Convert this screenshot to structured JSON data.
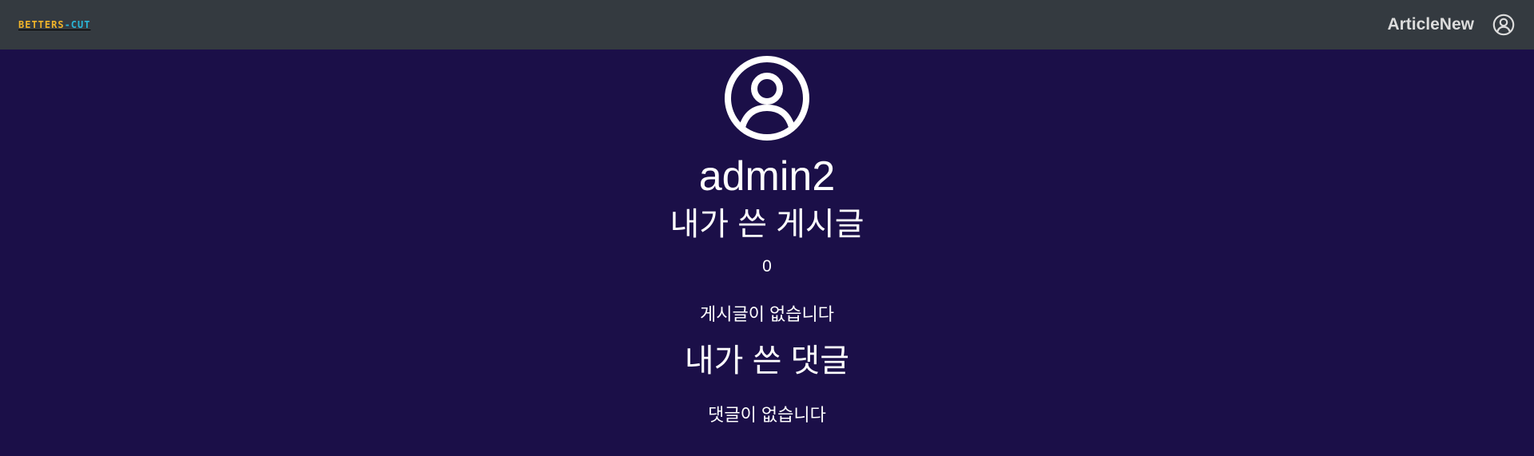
{
  "navbar": {
    "logo_left": "BETTERS",
    "logo_right": "-CUT",
    "article_new": "ArticleNew",
    "user_icon": "user-circle-icon"
  },
  "profile": {
    "avatar_icon": "user-circle-icon",
    "username": "admin2",
    "posts": {
      "title": "내가 쓴 게시글",
      "count": "0",
      "empty_message": "게시글이 없습니다"
    },
    "comments": {
      "title": "내가 쓴 댓글",
      "empty_message": "댓글이 없습니다"
    }
  },
  "colors": {
    "navbar_bg": "#343a40",
    "page_bg": "#1b0f48",
    "logo_yellow": "#f0b429",
    "logo_cyan": "#29b6d8"
  }
}
